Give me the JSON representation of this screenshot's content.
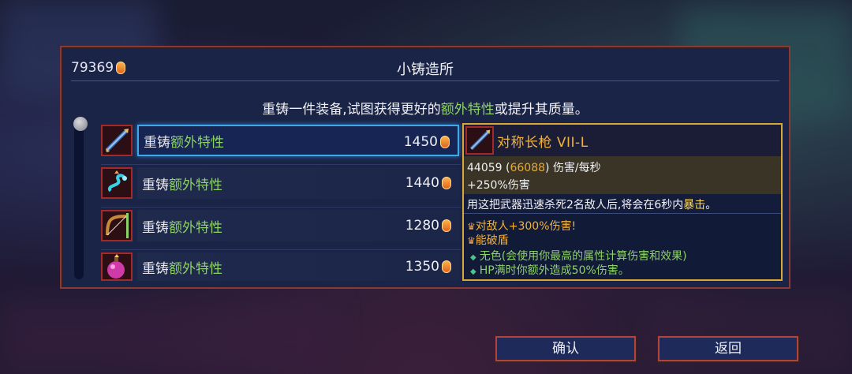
{
  "header": {
    "gold": "79369",
    "title": "小铸造所"
  },
  "description": {
    "prefix": "重铸一件装备,试图获得更好的",
    "highlight": "额外特性",
    "suffix": "或提升其质量。"
  },
  "items": [
    {
      "label_prefix": "重铸",
      "label_highlight": "额外特性",
      "cost": "1450",
      "icon": "spear-icon"
    },
    {
      "label_prefix": "重铸",
      "label_highlight": "额外特性",
      "cost": "1440",
      "icon": "serpent-whip-icon"
    },
    {
      "label_prefix": "重铸",
      "label_highlight": "额外特性",
      "cost": "1280",
      "icon": "bow-icon"
    },
    {
      "label_prefix": "重铸",
      "label_highlight": "额外特性",
      "cost": "1350",
      "icon": "bomb-icon"
    }
  ],
  "tooltip": {
    "name": "对称长枪  VII-L",
    "dps": "44059",
    "dps_crit": "66088",
    "dps_label": "伤害/每秒",
    "bonus": "+250%伤害",
    "effect_prefix": "用这把武器迅速杀死2名敌人后,将会在6秒内",
    "effect_highlight": "暴击",
    "effect_suffix": "。",
    "affix1": "对敌人+300%伤害!",
    "affix2": "能破盾",
    "trait1": "无色(会使用你最高的属性计算伤害和效果)",
    "trait2": "HP满时你额外造成50%伤害。"
  },
  "buttons": {
    "confirm": "确认",
    "back": "返回"
  },
  "colors": {
    "highlight_green": "#8ed06a",
    "selection_blue": "#40a8e8",
    "tooltip_gold": "#d9a63a",
    "frame_red": "#b4443a"
  }
}
